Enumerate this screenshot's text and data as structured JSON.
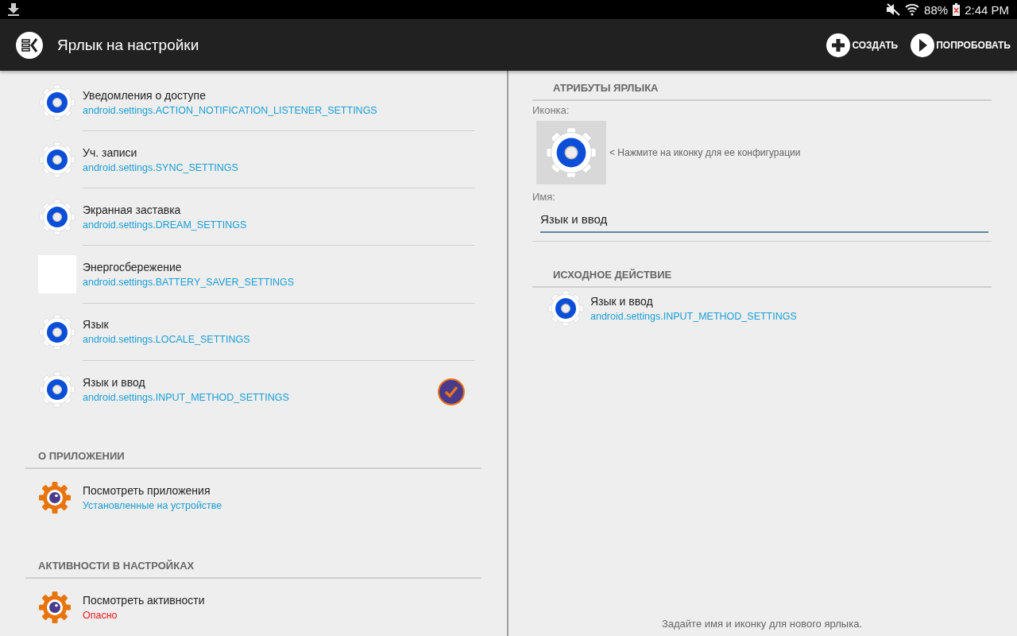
{
  "status_bar": {
    "battery": "88%",
    "time": "2:44 PM"
  },
  "app_bar": {
    "title": "Ярлык на настройки",
    "actions": [
      {
        "kind": "create",
        "label": "СОЗДАТЬ"
      },
      {
        "kind": "try",
        "label": "ПОПРОБОВАТЬ"
      }
    ]
  },
  "settings_list": [
    {
      "kind": "gear",
      "title": "Уведомления о доступе",
      "subtitle": "android.settings.ACTION_NOTIFICATION_LISTENER_SETTINGS",
      "selected": false
    },
    {
      "kind": "gear",
      "title": "Уч. записи",
      "subtitle": "android.settings.SYNC_SETTINGS",
      "selected": false
    },
    {
      "kind": "gear",
      "title": "Экранная заставка",
      "subtitle": "android.settings.DREAM_SETTINGS",
      "selected": false
    },
    {
      "kind": "blank",
      "title": "Энергосбережение",
      "subtitle": "android.settings.BATTERY_SAVER_SETTINGS",
      "selected": false
    },
    {
      "kind": "gear",
      "title": "Язык",
      "subtitle": "android.settings.LOCALE_SETTINGS",
      "selected": false
    },
    {
      "kind": "gear",
      "title": "Язык и ввод",
      "subtitle": "android.settings.INPUT_METHOD_SETTINGS",
      "selected": true
    }
  ],
  "sections": [
    {
      "header": "О ПРИЛОЖЕНИИ",
      "item": {
        "title": "Посмотреть приложения",
        "subtitle": "Установленные на устройстве",
        "warning": false
      }
    },
    {
      "header": "АКТИВНОСТИ В НАСТРОЙКАХ",
      "item": {
        "title": "Посмотреть активности",
        "subtitle": "Опасно",
        "warning": true
      }
    }
  ],
  "attributes": {
    "header": "АТРИБУТЫ ЯРЛЫКА",
    "icon_label": "Иконка:",
    "icon_hint": "< Нажмите на иконку для ее конфигурации",
    "name_label": "Имя:",
    "name_value": "Язык и ввод"
  },
  "source_action": {
    "header": "ИСХОДНОЕ ДЕЙСТВИЕ",
    "title": "Язык и ввод",
    "subtitle": "android.settings.INPUT_METHOD_SETTINGS"
  },
  "footer": "Задайте имя и иконку для нового ярлыка."
}
